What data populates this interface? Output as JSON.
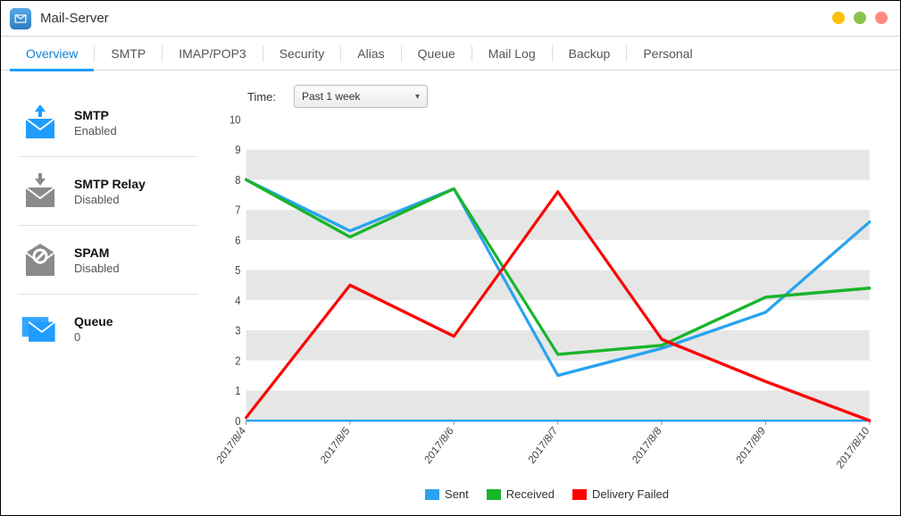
{
  "window": {
    "title": "Mail-Server"
  },
  "tabs": [
    "Overview",
    "SMTP",
    "IMAP/POP3",
    "Security",
    "Alias",
    "Queue",
    "Mail Log",
    "Backup",
    "Personal"
  ],
  "active_tab": 0,
  "sidebar": {
    "items": [
      {
        "icon": "mail-out",
        "title": "SMTP",
        "status": "Enabled"
      },
      {
        "icon": "mail-relay",
        "title": "SMTP Relay",
        "status": "Disabled"
      },
      {
        "icon": "mail-spam",
        "title": "SPAM",
        "status": "Disabled"
      },
      {
        "icon": "mail-queue",
        "title": "Queue",
        "status": "0"
      }
    ]
  },
  "time": {
    "label": "Time:",
    "selected": "Past 1 week"
  },
  "legend": {
    "sent": "Sent",
    "received": "Received",
    "failed": "Delivery Failed"
  },
  "colors": {
    "sent": "#29a3ef",
    "received": "#18b52a",
    "failed": "#ff0000",
    "enabled": "#1e9cff",
    "disabled": "#8a8a8a"
  },
  "chart_data": {
    "type": "line",
    "title": "",
    "xlabel": "",
    "ylabel": "",
    "ylim": [
      0,
      10
    ],
    "yticks": [
      0,
      1,
      2,
      3,
      4,
      5,
      6,
      7,
      8,
      9,
      10
    ],
    "categories": [
      "2017/8/4",
      "2017/8/5",
      "2017/8/6",
      "2017/8/7",
      "2017/8/8",
      "2017/8/9",
      "2017/8/10"
    ],
    "series": [
      {
        "name": "Sent",
        "color": "#29a3ef",
        "values": [
          8.0,
          6.3,
          7.7,
          1.5,
          2.4,
          3.6,
          6.6
        ]
      },
      {
        "name": "Received",
        "color": "#18b52a",
        "values": [
          8.0,
          6.1,
          7.7,
          2.2,
          2.5,
          4.1,
          4.4
        ]
      },
      {
        "name": "Delivery Failed",
        "color": "#ff0000",
        "values": [
          0.1,
          4.5,
          2.8,
          7.6,
          2.7,
          1.3,
          0.0
        ]
      }
    ],
    "legend_position": "bottom",
    "grid": true
  }
}
